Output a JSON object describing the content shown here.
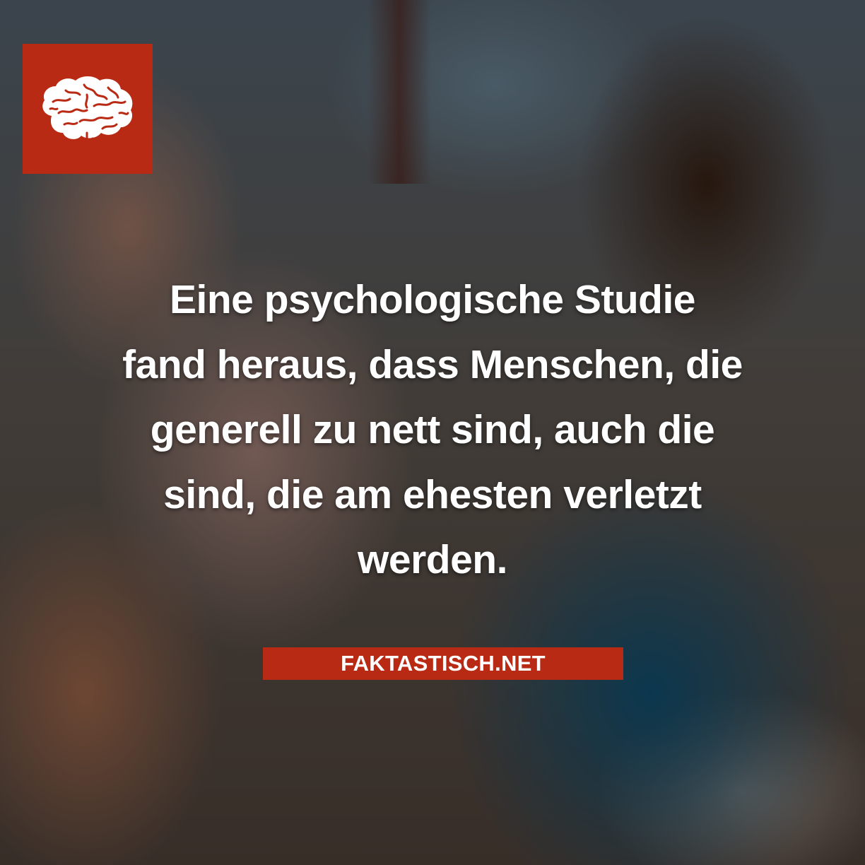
{
  "logo": {
    "icon": "brain-icon",
    "background_color": "#b82a13"
  },
  "fact": {
    "lines": [
      "Eine psychologische Studie",
      "fand heraus, dass Menschen, die",
      "generell zu nett sind, auch die",
      "sind, die am ehesten verletzt",
      "werden."
    ]
  },
  "brand": {
    "label": "FAKTASTISCH.NET",
    "background_color": "#b82a13"
  }
}
